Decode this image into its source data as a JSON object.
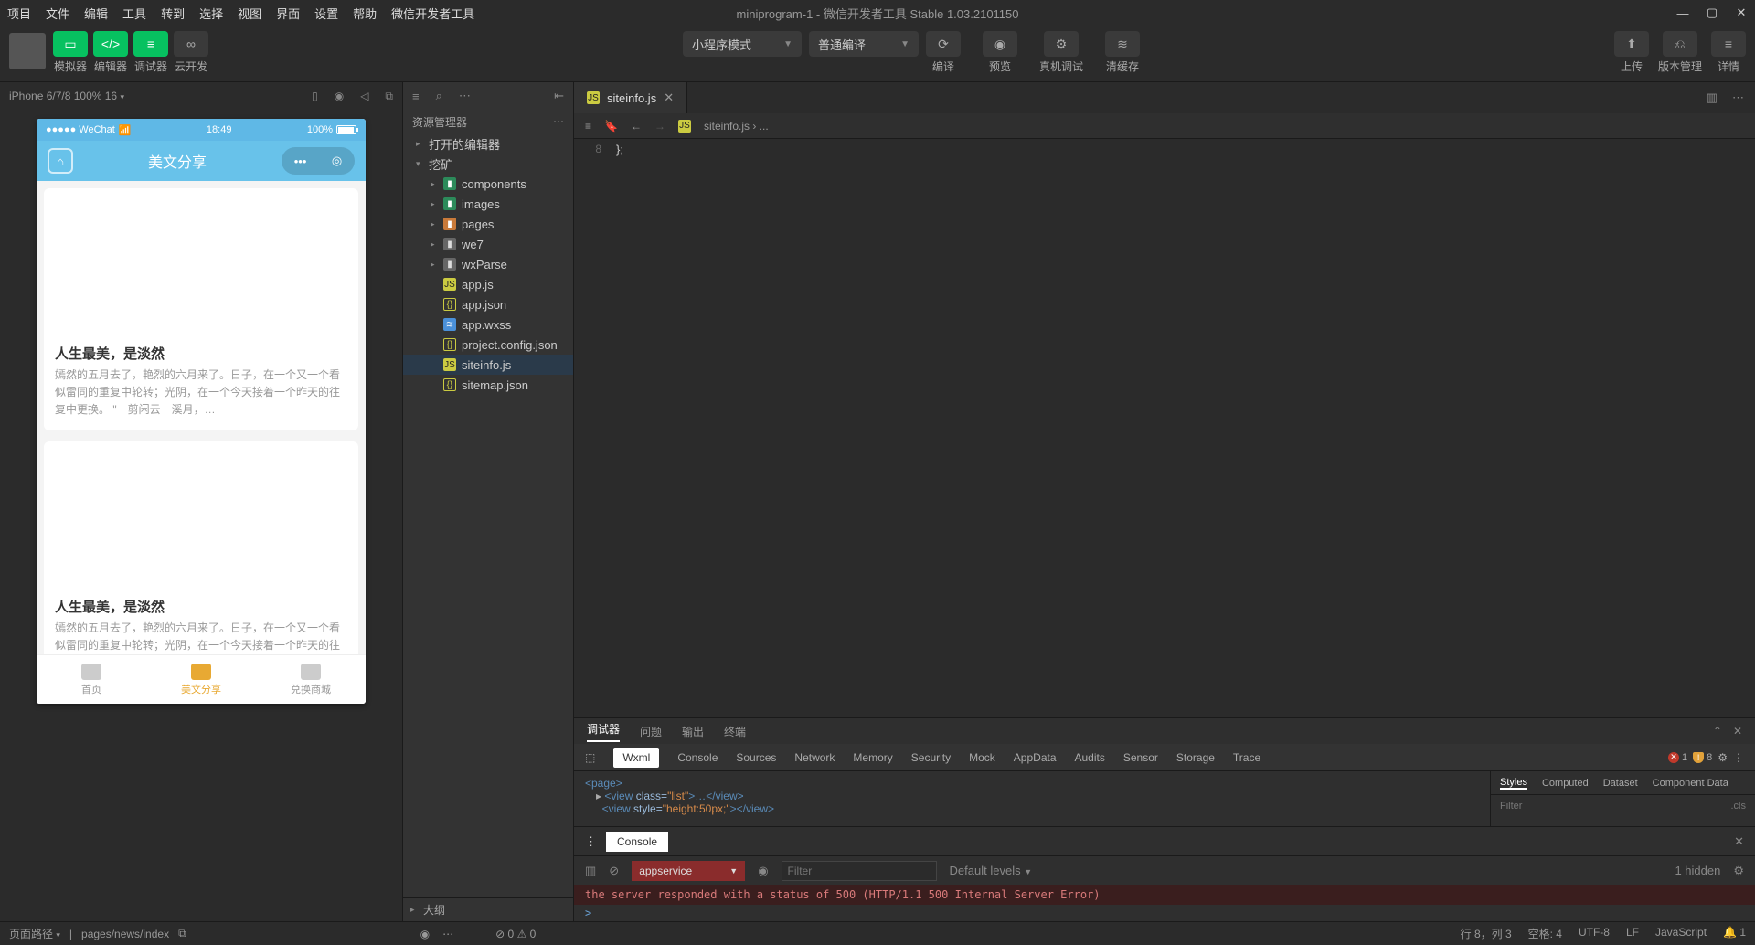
{
  "menubar": [
    "项目",
    "文件",
    "编辑",
    "工具",
    "转到",
    "选择",
    "视图",
    "界面",
    "设置",
    "帮助",
    "微信开发者工具"
  ],
  "window_title": "miniprogram-1 - 微信开发者工具 Stable 1.03.2101150",
  "toolbar": {
    "left": [
      {
        "label": "模拟器"
      },
      {
        "label": "编辑器"
      },
      {
        "label": "调试器"
      },
      {
        "label": "云开发"
      }
    ],
    "mode_dropdown": "小程序模式",
    "compile_dropdown": "普通编译",
    "center": [
      {
        "label": "编译"
      },
      {
        "label": "预览"
      },
      {
        "label": "真机调试"
      },
      {
        "label": "清缓存"
      }
    ],
    "right": [
      {
        "label": "上传"
      },
      {
        "label": "版本管理"
      },
      {
        "label": "详情"
      }
    ]
  },
  "simbar": {
    "device": "iPhone 6/7/8 100% 16"
  },
  "phone": {
    "carrier": "●●●●● WeChat",
    "time": "18:49",
    "battery": "100%",
    "nav_title": "美文分享",
    "card_title": "人生最美，是淡然",
    "card_desc": "嫣然的五月去了，艳烈的六月来了。日子，在一个又一个看似雷同的重复中轮转；光阴，在一个今天接着一个昨天的往复中更换。 \"一剪闲云一溪月，…",
    "tabs": [
      "首页",
      "美文分享",
      "兑换商城"
    ]
  },
  "explorer": {
    "title": "资源管理器",
    "sections": [
      "打开的编辑器",
      "挖矿"
    ],
    "files": [
      {
        "name": "components",
        "type": "folder-g"
      },
      {
        "name": "images",
        "type": "folder-g"
      },
      {
        "name": "pages",
        "type": "folder-o"
      },
      {
        "name": "we7",
        "type": "folder"
      },
      {
        "name": "wxParse",
        "type": "folder"
      },
      {
        "name": "app.js",
        "type": "js"
      },
      {
        "name": "app.json",
        "type": "json"
      },
      {
        "name": "app.wxss",
        "type": "wxss"
      },
      {
        "name": "project.config.json",
        "type": "json"
      },
      {
        "name": "siteinfo.js",
        "type": "js",
        "selected": true
      },
      {
        "name": "sitemap.json",
        "type": "json"
      }
    ],
    "outline": "大纲"
  },
  "editor": {
    "tab": "siteinfo.js",
    "breadcrumb": "siteinfo.js › ...",
    "line_no": "8",
    "code": "};"
  },
  "panel": {
    "tabs": [
      "调试器",
      "问题",
      "输出",
      "终端"
    ],
    "devtabs": [
      "Wxml",
      "Console",
      "Sources",
      "Network",
      "Memory",
      "Security",
      "Mock",
      "AppData",
      "Audits",
      "Sensor",
      "Storage",
      "Trace"
    ],
    "errors": "1",
    "warnings": "8",
    "styles_tabs": [
      "Styles",
      "Computed",
      "Dataset",
      "Component Data"
    ],
    "filter_ph": "Filter",
    "cls": ".cls",
    "dom": {
      "l1": "<page>",
      "l2a": "<view",
      "l2a_cls": "class=",
      "l2a_v": "\"list\"",
      "l2a_end": ">…</view>",
      "l3a": "<view",
      "l3a_sty": "style=",
      "l3a_v": "\"height:50px;\"",
      "l3a_end": "></view>"
    },
    "console": {
      "title": "Console",
      "context": "appservice",
      "filter_ph": "Filter",
      "levels": "Default levels",
      "hidden": "1 hidden",
      "err_line": "the server responded with a status of 500 (HTTP/1.1 500 Internal Server Error)",
      "prompt": ">"
    }
  },
  "statusbar": {
    "path_label": "页面路径",
    "path": "pages/news/index",
    "err0": "0",
    "warn0": "0",
    "pos": "行 8，列 3",
    "spaces": "空格: 4",
    "enc": "UTF-8",
    "eol": "LF",
    "lang": "JavaScript",
    "notif": "1"
  }
}
